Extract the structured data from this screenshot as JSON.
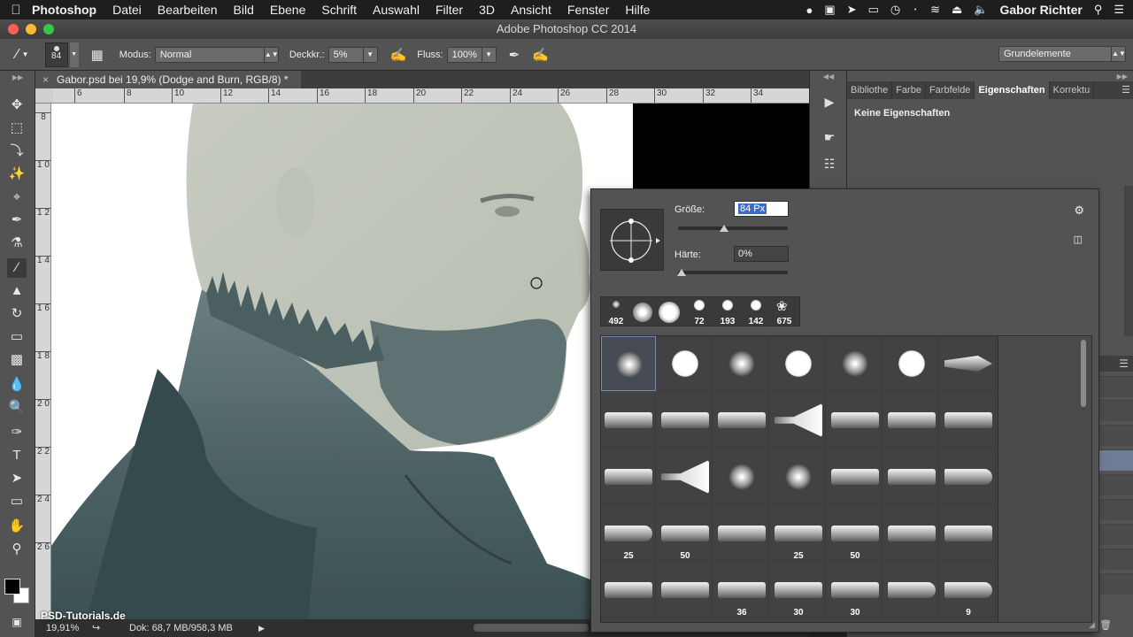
{
  "menubar": {
    "app": "Photoshop",
    "items": [
      "Datei",
      "Bearbeiten",
      "Bild",
      "Ebene",
      "Schrift",
      "Auswahl",
      "Filter",
      "3D",
      "Ansicht",
      "Fenster",
      "Hilfe"
    ],
    "user": "Gabor Richter"
  },
  "window": {
    "title": "Adobe Photoshop CC 2014"
  },
  "options": {
    "size_value": "84",
    "mode_label": "Modus:",
    "mode_value": "Normal",
    "opacity_label": "Deckkr.:",
    "opacity_value": "5%",
    "flow_label": "Fluss:",
    "flow_value": "100%",
    "workspace": "Grundelemente"
  },
  "document": {
    "tab_title": "Gabor.psd bei 19,9% (Dodge and Burn, RGB/8) *",
    "zoom": "19,91%",
    "doc_size": "Dok: 68,7 MB/958,3 MB",
    "watermark": "PSD-Tutorials.de"
  },
  "rulers": {
    "horizontal": [
      "6",
      "8",
      "10",
      "12",
      "14",
      "16",
      "18",
      "20",
      "22",
      "24",
      "26",
      "28",
      "30",
      "32",
      "34"
    ],
    "vertical": [
      "8",
      "1 0",
      "1 2",
      "1 4",
      "1 6",
      "1 8",
      "2 0",
      "2 2",
      "2 4",
      "2 6"
    ]
  },
  "properties": {
    "tabs": [
      "Bibliothe",
      "Farbe",
      "Farbfelde",
      "Eigenschaften",
      "Korrektu"
    ],
    "active_tab": "Eigenschaften",
    "empty_text": "Keine Eigenschaften"
  },
  "brush_picker": {
    "size_label": "Größe:",
    "size_value": "84 Px",
    "size_fraction": 0.42,
    "hardness_label": "Härte:",
    "hardness_value": "0%",
    "hardness_fraction": 0.0,
    "recent": [
      "492",
      "",
      "",
      "72",
      "193",
      "142",
      "675"
    ],
    "grid_labels": [
      [
        "",
        "",
        "",
        "",
        "",
        "",
        ""
      ],
      [
        "",
        "",
        "",
        "",
        "",
        "",
        ""
      ],
      [
        "",
        "",
        "",
        "",
        "",
        "",
        ""
      ],
      [
        "25",
        "50",
        "",
        "25",
        "50",
        "",
        ""
      ],
      [
        "",
        "",
        "36",
        "30",
        "30",
        "",
        "9"
      ]
    ]
  },
  "icons": {
    "apple": "apple-icon",
    "brush_tool": "brush-icon",
    "settings": "gear-icon"
  }
}
